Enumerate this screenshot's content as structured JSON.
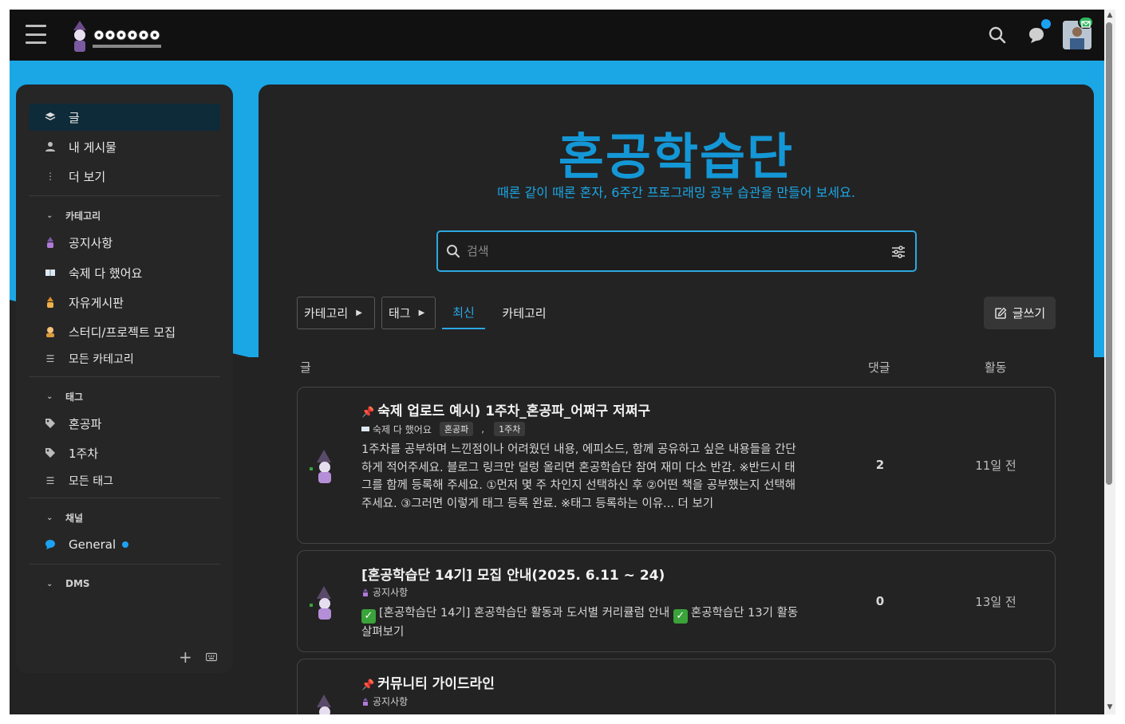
{
  "header": {
    "menu_icon": "hamburger-menu-icon",
    "logo_icon": "honggong-logo-icon",
    "search_icon": "search-icon",
    "chat_icon": "chat-icon",
    "avatar_icon": "user-avatar-icon"
  },
  "sidebar": {
    "nav": [
      {
        "label": "글",
        "icon": "stack-icon",
        "active": true
      },
      {
        "label": "내 게시물",
        "icon": "person-icon"
      },
      {
        "label": "더 보기",
        "icon": "more-vertical-icon"
      }
    ],
    "category_head": "카테고리",
    "categories": [
      {
        "label": "공지사항",
        "icon": "wizard-icon"
      },
      {
        "label": "숙제 다 했어요",
        "icon": "book-icon"
      },
      {
        "label": "자유게시판",
        "icon": "wizard-orange-icon"
      },
      {
        "label": "스터디/프로젝트 모집",
        "icon": "person-emoji-icon"
      },
      {
        "label": "모든 카테고리",
        "icon": "list-icon"
      }
    ],
    "tag_head": "태그",
    "tags": [
      {
        "label": "혼공파",
        "icon": "tag-icon"
      },
      {
        "label": "1주차",
        "icon": "tag-icon"
      },
      {
        "label": "모든 태그",
        "icon": "list-icon"
      }
    ],
    "channel_head": "채널",
    "channels": [
      {
        "label": "General",
        "icon": "chat-bubble-icon"
      }
    ],
    "dm_head": "DMS",
    "footer_add": "+",
    "footer_keyboard_icon": "keyboard-icon"
  },
  "main": {
    "title": "혼공학습단",
    "subtitle": "때론 같이 때론 혼자, 6주간 프로그래밍 공부 습관을 만들어 보세요.",
    "search_placeholder": "검색",
    "filter_category": "카테고리",
    "filter_tag": "태그",
    "tab_latest": "최신",
    "tab_categories": "카테고리",
    "write_label": "글쓰기",
    "col_topic": "글",
    "col_replies": "댓글",
    "col_activity": "활동"
  },
  "posts": [
    {
      "pinned": true,
      "title": "숙제 업로드 예시) 1주차_혼공파_어쩌구 저쩌구",
      "category": "숙제 다 했어요",
      "tags": [
        "혼공파",
        "1주차"
      ],
      "tag_sep": ",",
      "excerpt": "1주차를 공부하며 느낀점이나 어려웠던 내용, 에피소드, 함께 공유하고 싶은 내용들을 간단하게 적어주세요. 블로그 링크만 덜렁 올리면 혼공학습단 참여 재미 다소 반감.         ※반드시 태그를 함께 등록해 주세요. ①먼저 몇 주 차인지 선택하신 후 ②어떤 책을 공부했는지 선택해 주세요. ③그러면 이렇게 태그 등록 완료.          ※태그 등록하는 이유... 더 보기",
      "replies": "2",
      "activity": "11일 전"
    },
    {
      "pinned": false,
      "title": "[혼공학습단 14기] 모집 안내(2025. 6.11 ~ 24)",
      "category": "공지사항",
      "excerpt_a": "[혼공학습단 14기] 혼공학습단 활동과 도서별 커리큘럼 안내",
      "excerpt_b": "혼공학습단 13기 활동 살펴보기",
      "replies": "0",
      "activity": "13일 전"
    },
    {
      "pinned": true,
      "title": "커뮤니티 가이드라인",
      "category": "공지사항"
    }
  ]
}
